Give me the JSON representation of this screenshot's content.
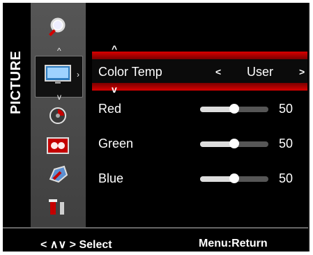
{
  "side_label": "PICTURE",
  "selected_row": {
    "label": "Color Temp",
    "value": "User",
    "left_arrow": "<",
    "right_arrow": ">"
  },
  "rows": [
    {
      "label": "Red",
      "value": "50",
      "level_percent": 50
    },
    {
      "label": "Green",
      "value": "50",
      "level_percent": 50
    },
    {
      "label": "Blue",
      "value": "50",
      "level_percent": 50
    }
  ],
  "footer": {
    "select_hint": "< ∧∨ > Select",
    "menu_hint": "Menu:Return"
  },
  "icons": [
    {
      "name": "magnifier"
    },
    {
      "name": "picture-display"
    },
    {
      "name": "sound-disc"
    },
    {
      "name": "pip-pop"
    },
    {
      "name": "settings-gear"
    },
    {
      "name": "tools"
    }
  ]
}
